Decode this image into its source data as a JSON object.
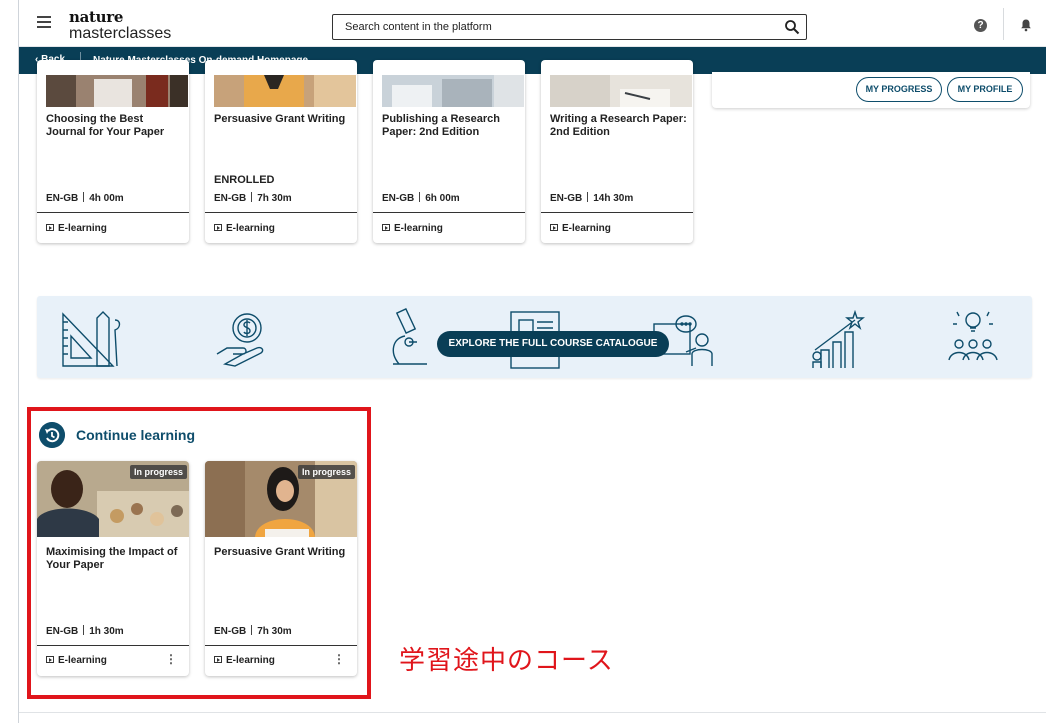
{
  "header": {
    "brand_line1": "nature",
    "brand_line2": "masterclasses",
    "search_placeholder": "Search content in the platform",
    "help_glyph": "?",
    "icons": [
      "menu-icon",
      "search-icon",
      "help-icon",
      "bell-icon"
    ]
  },
  "nav": {
    "back_label": "Back",
    "title": "Nature Masterclasses On-demand Homepage"
  },
  "profile_panel": {
    "progress_label": "MY PROGRESS",
    "profile_label": "MY PROFILE"
  },
  "courses": [
    {
      "title": "Choosing the Best Journal for Your Paper",
      "status": "",
      "lang": "EN-GB",
      "duration": "4h 00m",
      "type": "E-learning"
    },
    {
      "title": "Persuasive Grant Writing",
      "status": "ENROLLED",
      "lang": "EN-GB",
      "duration": "7h 30m",
      "type": "E-learning"
    },
    {
      "title": "Publishing a Research Paper: 2nd Edition",
      "status": "",
      "lang": "EN-GB",
      "duration": "6h 00m",
      "type": "E-learning"
    },
    {
      "title": "Writing a Research Paper: 2nd Edition",
      "status": "",
      "lang": "EN-GB",
      "duration": "14h 30m",
      "type": "E-learning"
    }
  ],
  "explore": {
    "button_label": "EXPLORE THE FULL COURSE CATALOGUE"
  },
  "continue_learning": {
    "heading": "Continue learning",
    "items": [
      {
        "badge": "In progress",
        "title": "Maximising the Impact of Your Paper",
        "lang": "EN-GB",
        "duration": "1h 30m",
        "type": "E-learning",
        "more": "⋮"
      },
      {
        "badge": "In progress",
        "title": "Persuasive Grant Writing",
        "lang": "EN-GB",
        "duration": "7h 30m",
        "type": "E-learning",
        "more": "⋮"
      }
    ]
  },
  "annotation": "学習途中のコース",
  "colors": {
    "brand_dark": "#093e56",
    "accent": "#0e4d6b",
    "highlight_red": "#e0151b",
    "banner_bg": "#e8f1f9"
  }
}
